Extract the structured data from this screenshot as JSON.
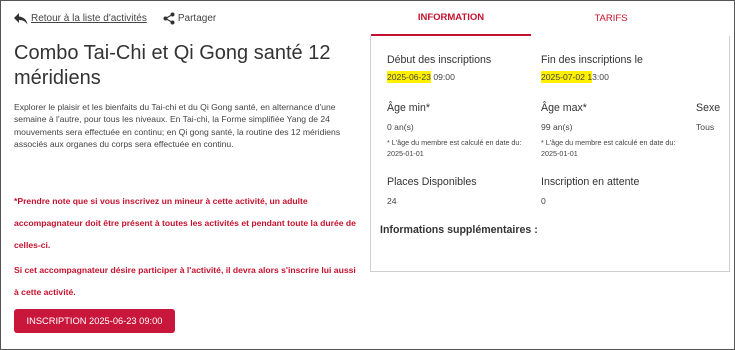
{
  "nav": {
    "back_label": "Retour à la liste d'activités",
    "share_label": "Partager"
  },
  "activity": {
    "title": "Combo Tai-Chi et Qi Gong santé 12 méridiens",
    "description": "Explorer le plaisir et les bienfaits du Tai-chi et du Qi Gong santé, en alternance d'une semaine à l'autre, pour tous les niveaux. En Tai-chi, la Forme simplifiée Yang de 24 mouvements sera effectuée en continu; en Qi gong santé, la routine des 12 méridiens associés aux organes du corps sera effectuée en continu.",
    "warning_1": "*Prendre note que si vous inscrivez un mineur à cette activité, un adulte accompagnateur doit être présent à toutes les activités et pendant toute la durée de celles-ci.",
    "warning_2": "Si cet accompagnateur désire participer à l'activité, il devra alors s'inscrire lui aussi à cette activité.",
    "register_button": "INSCRIPTION 2025-06-23 09:00"
  },
  "tabs": {
    "information": "INFORMATION",
    "tarifs": "TARIFS"
  },
  "info": {
    "start_label": "Début des inscriptions",
    "start_date": "2025-06-23",
    "start_time": " 09:00",
    "end_label": "Fin des inscriptions le",
    "end_date_hl": "2025-07-02 1",
    "end_date_rest": "3:00",
    "age_min_label": "Âge min*",
    "age_min_value": "0 an(s)",
    "age_min_note": "* L'âge du membre est calculé en date du: 2025-01-01",
    "age_max_label": "Âge max*",
    "age_max_value": "99 an(s)",
    "age_max_note": "* L'âge du membre est calculé en date du: 2025-01-01",
    "sex_label": "Sexe",
    "sex_value": "Tous",
    "places_label": "Places Disponibles",
    "places_value": "24",
    "waitlist_label": "Inscription en attente",
    "waitlist_value": "0",
    "extra_label": "Informations supplémentaires :"
  },
  "colors": {
    "accent": "#c4122e",
    "button": "#c8173b",
    "highlight": "#fff000"
  },
  "icons": {
    "back": "reply-arrow-icon",
    "share": "share-icon"
  }
}
